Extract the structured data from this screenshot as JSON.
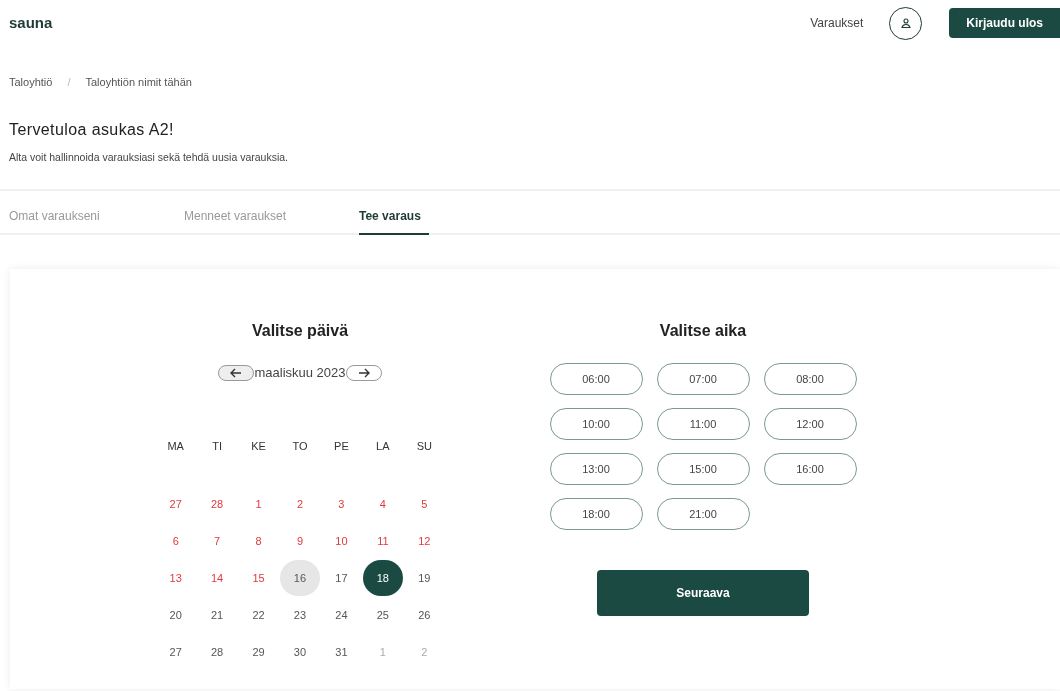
{
  "header": {
    "logo": "sauna",
    "nav_link": "Varaukset",
    "logout_button": "Kirjaudu ulos"
  },
  "breadcrumb": [
    "Taloyhtiö",
    "Taloyhtiön nimit tähän"
  ],
  "breadcrumb_separator": "/",
  "welcome": {
    "title": "Tervetuloa asukas A2!",
    "subtitle": "Alta voit hallinnoida varauksiasi sekä tehdä uusia varauksia."
  },
  "tabs": [
    {
      "label": "Omat varaukseni",
      "selected": false
    },
    {
      "label": "Menneet varaukset",
      "selected": false
    },
    {
      "label": "Tee varaus",
      "selected": true
    }
  ],
  "calendar": {
    "title": "Valitse päivä",
    "month": "maaliskuu 2023",
    "weekdays": [
      "MA",
      "TI",
      "KE",
      "TO",
      "PE",
      "LA",
      "SU"
    ],
    "days": [
      {
        "day": "27",
        "kind": "blocked",
        "selected": false,
        "today": false
      },
      {
        "day": "28",
        "kind": "blocked",
        "selected": false,
        "today": false
      },
      {
        "day": "1",
        "kind": "blocked",
        "selected": false,
        "today": false
      },
      {
        "day": "2",
        "kind": "blocked",
        "selected": false,
        "today": false
      },
      {
        "day": "3",
        "kind": "blocked",
        "selected": false,
        "today": false
      },
      {
        "day": "4",
        "kind": "blocked",
        "selected": false,
        "today": false
      },
      {
        "day": "5",
        "kind": "blocked",
        "selected": false,
        "today": false
      },
      {
        "day": "6",
        "kind": "blocked",
        "selected": false,
        "today": false
      },
      {
        "day": "7",
        "kind": "blocked",
        "selected": false,
        "today": false
      },
      {
        "day": "8",
        "kind": "blocked",
        "selected": false,
        "today": false
      },
      {
        "day": "9",
        "kind": "blocked",
        "selected": false,
        "today": false
      },
      {
        "day": "10",
        "kind": "blocked",
        "selected": false,
        "today": false
      },
      {
        "day": "11",
        "kind": "blocked",
        "selected": false,
        "today": false
      },
      {
        "day": "12",
        "kind": "blocked",
        "selected": false,
        "today": false
      },
      {
        "day": "13",
        "kind": "blocked",
        "selected": false,
        "today": false
      },
      {
        "day": "14",
        "kind": "blocked",
        "selected": false,
        "today": false
      },
      {
        "day": "15",
        "kind": "blocked",
        "selected": false,
        "today": false
      },
      {
        "day": "16",
        "kind": "normal",
        "selected": false,
        "today": true
      },
      {
        "day": "17",
        "kind": "normal",
        "selected": false,
        "today": false
      },
      {
        "day": "18",
        "kind": "normal",
        "selected": true,
        "today": false
      },
      {
        "day": "19",
        "kind": "normal",
        "selected": false,
        "today": false
      },
      {
        "day": "20",
        "kind": "normal",
        "selected": false,
        "today": false
      },
      {
        "day": "21",
        "kind": "normal",
        "selected": false,
        "today": false
      },
      {
        "day": "22",
        "kind": "normal",
        "selected": false,
        "today": false
      },
      {
        "day": "23",
        "kind": "normal",
        "selected": false,
        "today": false
      },
      {
        "day": "24",
        "kind": "normal",
        "selected": false,
        "today": false
      },
      {
        "day": "25",
        "kind": "normal",
        "selected": false,
        "today": false
      },
      {
        "day": "26",
        "kind": "normal",
        "selected": false,
        "today": false
      },
      {
        "day": "27",
        "kind": "normal",
        "selected": false,
        "today": false
      },
      {
        "day": "28",
        "kind": "normal",
        "selected": false,
        "today": false
      },
      {
        "day": "29",
        "kind": "normal",
        "selected": false,
        "today": false
      },
      {
        "day": "30",
        "kind": "normal",
        "selected": false,
        "today": false
      },
      {
        "day": "31",
        "kind": "normal",
        "selected": false,
        "today": false
      },
      {
        "day": "1",
        "kind": "other",
        "selected": false,
        "today": false
      },
      {
        "day": "2",
        "kind": "other",
        "selected": false,
        "today": false
      }
    ]
  },
  "times": {
    "title": "Valitse aika",
    "slots": [
      {
        "label": "06:00",
        "selected": false
      },
      {
        "label": "07:00",
        "selected": false
      },
      {
        "label": "08:00",
        "selected": false
      },
      {
        "label": "10:00",
        "selected": false
      },
      {
        "label": "11:00",
        "selected": false
      },
      {
        "label": "12:00",
        "selected": false
      },
      {
        "label": "13:00",
        "selected": false
      },
      {
        "label": "15:00",
        "selected": false
      },
      {
        "label": "16:00",
        "selected": false
      },
      {
        "label": "18:00",
        "selected": false
      },
      {
        "label": "21:00",
        "selected": false
      }
    ],
    "next_button": "Seuraava"
  }
}
